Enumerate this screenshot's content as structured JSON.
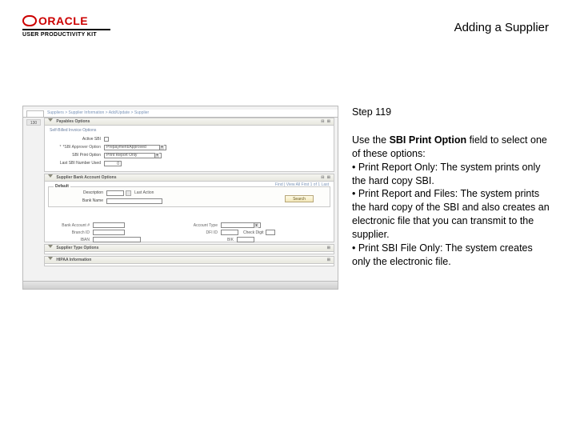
{
  "header": {
    "brand_word": "ORACLE",
    "subbrand": "USER PRODUCTIVITY KIT",
    "page_title": "Adding a Supplier"
  },
  "instructions": {
    "step_label": "Step 119",
    "intro_pre": "Use the ",
    "intro_bold": "SBI Print Option",
    "intro_post": " field to select one of these options:",
    "bullet1": "• Print Report Only: The system prints only the hard copy SBI.",
    "bullet2": "• Print Report and Files: The system prints the hard copy of the SBI and also creates an electronic file that you can transmit to the supplier.",
    "bullet3": "• Print SBI File Only: The system creates only the electronic file."
  },
  "shot": {
    "breadcrumb": "Suppliers  >  Supplier Information  >  Add/Update  >  Supplier",
    "rownum": "130",
    "panel1": {
      "title": "Payables Options",
      "sub": "Self-Billed Invoice Options",
      "active_label": "Active SBI",
      "approver_label": "*SBI Approver Option",
      "approver_value": "Prepayment/Approved",
      "print_label": "SBI Print Option",
      "print_value": "Print Report Only",
      "seq_label": "Last SBI Number Used",
      "seq_value": "0"
    },
    "panel2": {
      "title": "Supplier Bank Account Options",
      "meta": "Find | View All   First 1 of 1 Last",
      "default_label": "Default",
      "description_label": "Description",
      "bankname_label": "Bank Name",
      "last_action": "Last Action",
      "search_btn": "Search",
      "bankacct_label": "Bank Account #",
      "branch_label": "Branch ID",
      "iban_label": "IBAN",
      "acct_type_label": "Account Type",
      "dfi_label": "DFI ID",
      "bik_label": "BIK",
      "check_digit_label": "Check Digit"
    },
    "panel3": {
      "title": "Supplier Type Options"
    },
    "panel4": {
      "title": "HIPAA Information"
    }
  }
}
